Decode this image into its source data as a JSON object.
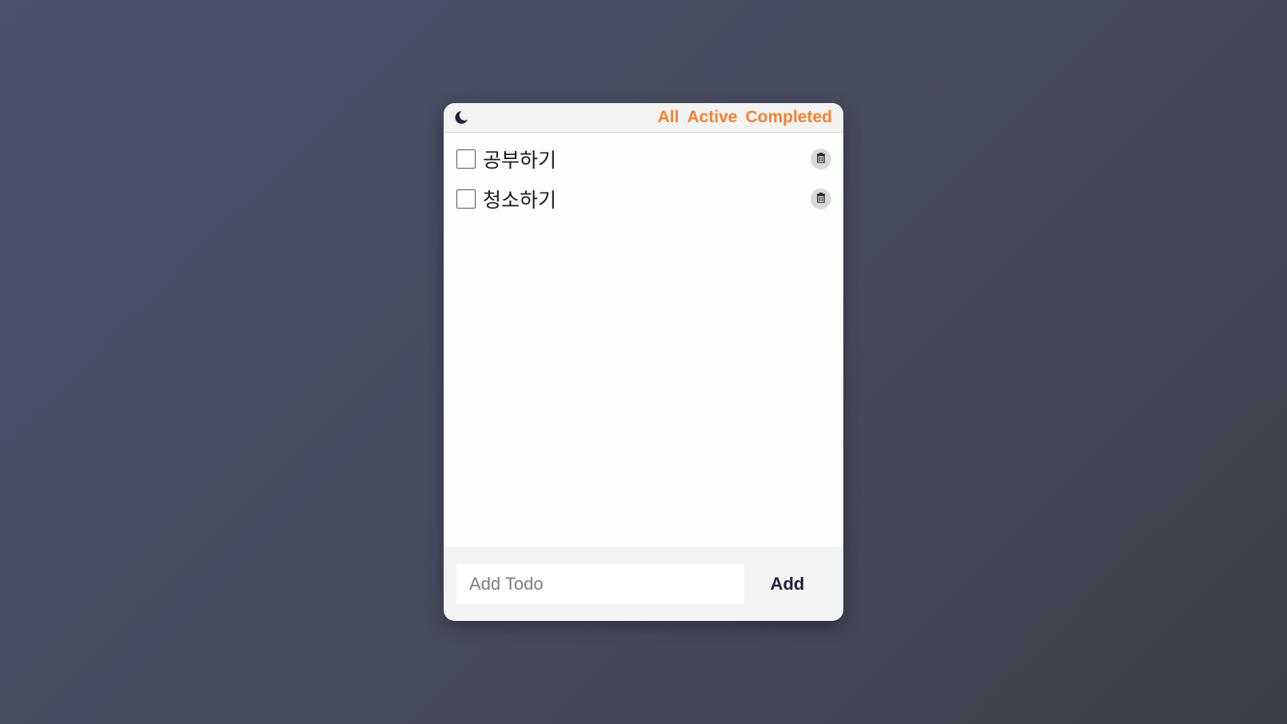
{
  "colors": {
    "accent": "#f5822f",
    "card_background": "#fdfffc",
    "header_background": "#f3f3f3",
    "icon_dark": "#22243a"
  },
  "header": {
    "theme_icon": "moon-icon",
    "filters": [
      {
        "label": "All"
      },
      {
        "label": "Active"
      },
      {
        "label": "Completed"
      }
    ]
  },
  "todos": [
    {
      "text": "공부하기",
      "completed": false,
      "delete_icon": "trash-icon"
    },
    {
      "text": "청소하기",
      "completed": false,
      "delete_icon": "trash-icon"
    }
  ],
  "form": {
    "input_value": "",
    "input_placeholder": "Add Todo",
    "add_label": "Add"
  }
}
